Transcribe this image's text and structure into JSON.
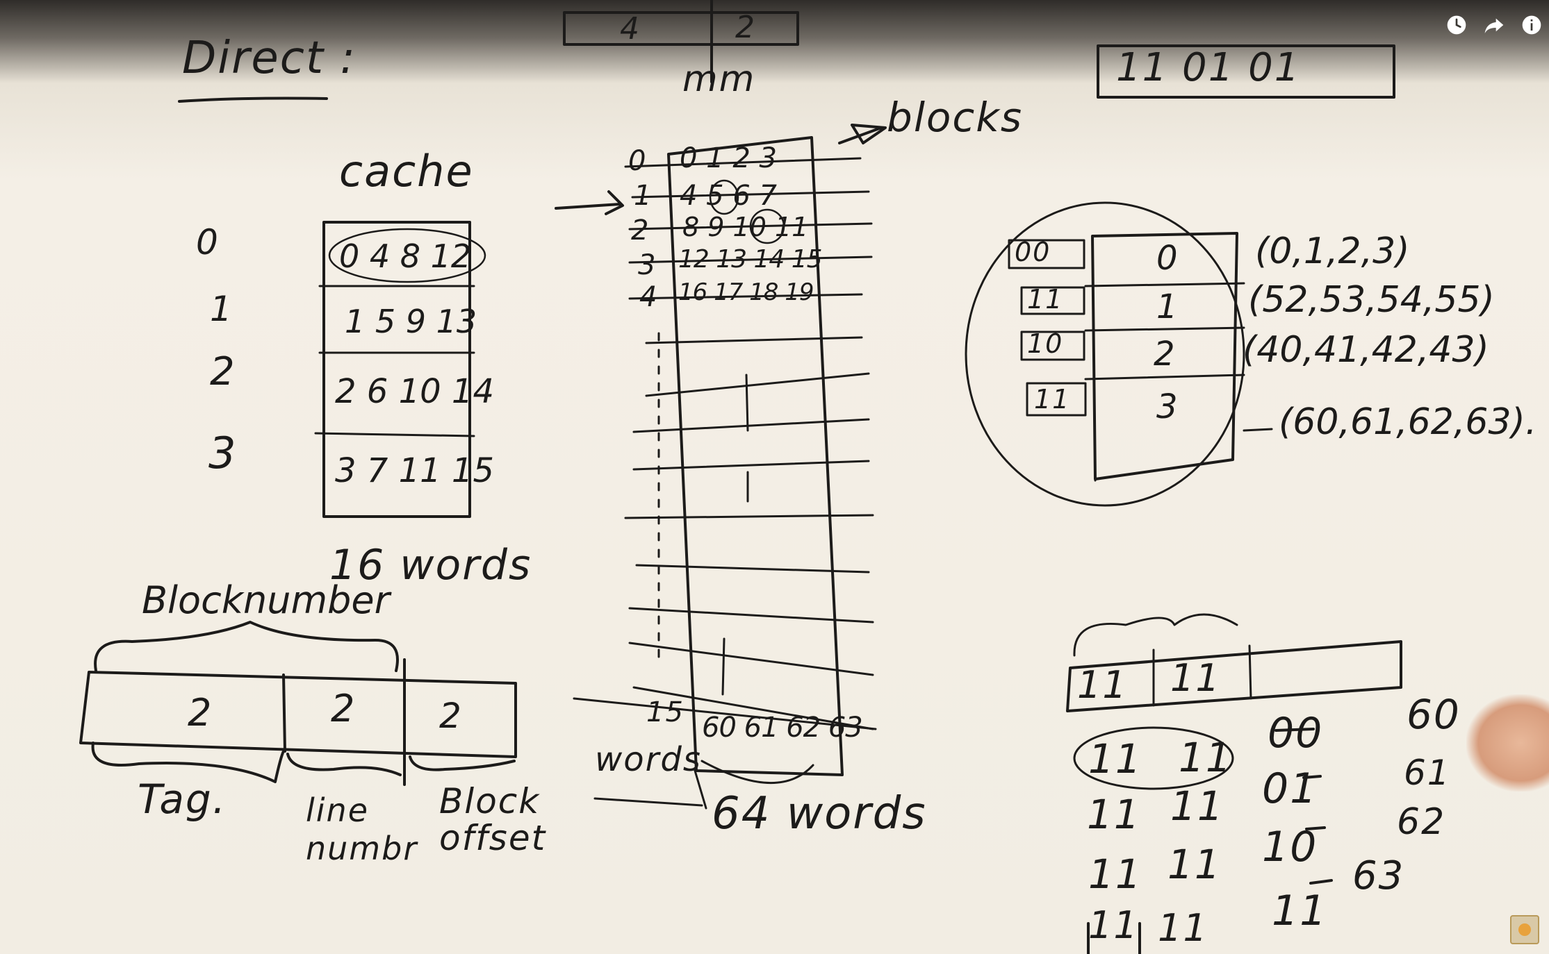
{
  "player": {
    "controls": {
      "watch_later_icon": "clock-icon",
      "share_icon": "share-arrow-icon",
      "info_icon": "info-icon"
    },
    "channel_logo_icon": "channel-logo-icon"
  },
  "board": {
    "heading": "Direct :",
    "address_top": {
      "left": "4",
      "right": "2"
    },
    "binary_address": "11 01 01",
    "cache": {
      "title": "cache",
      "line_numbers": [
        "0",
        "1",
        "2",
        "3"
      ],
      "rows": [
        "0 4 8 12",
        "1 5 9 13",
        "2 6 10 14",
        "3 7 11 15"
      ],
      "size_label": "16 words"
    },
    "main_memory": {
      "title": "mm",
      "blocks_label": "blocks",
      "row_numbers": [
        "0",
        "1",
        "2",
        "3",
        "4"
      ],
      "rows": [
        "0 1 2 3",
        "4 5 6 7",
        "8 9 10 11",
        "12 13 14 15",
        "16 17 18 19"
      ],
      "last_row_number": "15",
      "last_row": "60 61 62 63",
      "words_label": "words",
      "size_label": "64 words"
    },
    "address_format": {
      "block_number_label": "Blocknumber",
      "fields": [
        "2",
        "2",
        "2"
      ],
      "labels": [
        "Tag.",
        "line numbr",
        "Block offset"
      ]
    },
    "circled_cache": {
      "tags": [
        "00",
        "11",
        "10",
        "11"
      ],
      "lines": [
        "0",
        "1",
        "2",
        "3"
      ],
      "contents": [
        "(0,1,2,3)",
        "(52,53,54,55)",
        "(40,41,42,43)",
        "(60,61,62,63)."
      ]
    },
    "bottom_right": {
      "prefix_bits": [
        "11",
        "11"
      ],
      "rows": [
        {
          "a": "11",
          "b": "11",
          "offset": "00",
          "word": "60"
        },
        {
          "a": "11",
          "b": "11",
          "offset": "01",
          "word": "61"
        },
        {
          "a": "11",
          "b": "11",
          "offset": "10",
          "word": "62"
        },
        {
          "a": "11",
          "b": "11",
          "offset": "11",
          "word": "63"
        }
      ]
    }
  }
}
